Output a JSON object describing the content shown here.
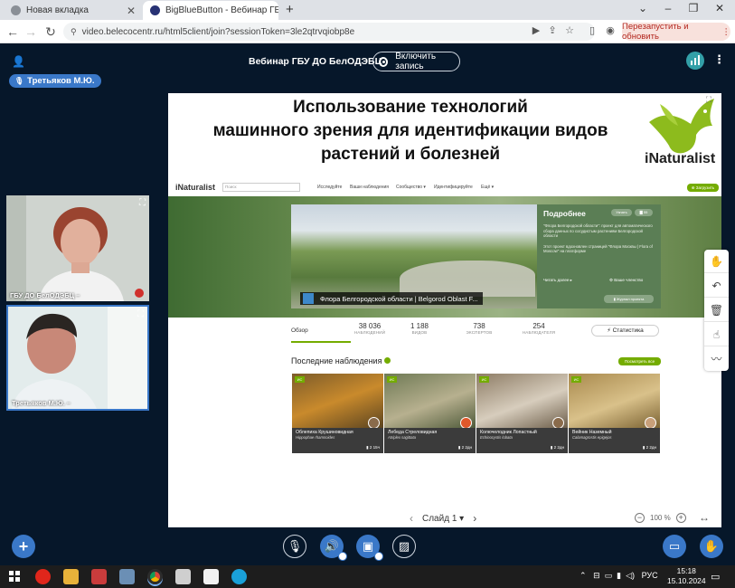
{
  "browser": {
    "tabs": [
      {
        "title": "Новая вкладка",
        "active": false
      },
      {
        "title": "BigBlueButton - Вебинар ГБ",
        "active": true
      }
    ],
    "url": "video.belecocentr.ru/html5client/join?sessionToken=3le2qtrvqiobp8e",
    "relaunch_label": "Перезапустить и обновить",
    "new_tab_symbol": "+"
  },
  "meeting": {
    "title": "Вебинар ГБУ ДО БелОДЭБЦ",
    "record_label": "Включить запись",
    "talking_user": "Третьяков М.Ю."
  },
  "webcams": [
    {
      "label": "ГБУ ДО БелОДЭБЦ –",
      "muted": true
    },
    {
      "label": "Третьяков М.Ю. –",
      "muted": false
    }
  ],
  "slide": {
    "title_lines": [
      "Использование технологий",
      "машинного зрения для идентификации видов",
      "растений и болезней"
    ],
    "logo_text": "iNaturalist",
    "inat": {
      "logo": "iNaturalist",
      "search_placeholder": "Поиск",
      "menu": [
        "Исследуйте",
        "Ваши наблюдения",
        "Сообщество ▾",
        "Идентифицируйте",
        "Ещё ▾"
      ],
      "upload": "⊕ Загрузить",
      "project_title": "Флора Белгородской области | Belgorod Oblast F...",
      "info_heading": "Подробнее",
      "info_text_1": "\"Флора Белгородской области\": проект для автоматического сбора данных по сосудистым растениям Белгородской области",
      "info_text_2": "Этот проект вдохновлен страницей \"Флора Москвы | Flora of Moscow\" на платформе",
      "read_more": "Читать далее ▸",
      "membership": "⚙ Ваше членство",
      "follow": "Узнать",
      "follow_count": "▇ 55",
      "rules": "▮ Журнал проекта",
      "overview_tab": "Обзор",
      "stats": [
        {
          "value": "38 036",
          "label": "НАБЛЮДЕНИЙ"
        },
        {
          "value": "1 188",
          "label": "ВИДОВ"
        },
        {
          "value": "738",
          "label": "ЭКСПЕРТОВ"
        },
        {
          "value": "254",
          "label": "НАБЛЮДАТЕЛЯ"
        }
      ],
      "stats_button": "⚡ Статистика",
      "recent_title": "Последние наблюдения",
      "see_all": "Посмотреть все",
      "observations": [
        {
          "tag": "ИС",
          "common": "Облепиха Крушиновидная",
          "sci": "Hippophae rhamnoides",
          "age": "▮ 2 15ч",
          "color_a": "#7d5c2a",
          "color_b": "#c98a2c"
        },
        {
          "tag": "ИС",
          "common": "Лебеда Стреловидная",
          "sci": "Atriplex sagittata",
          "age": "▮ 2 2дн",
          "color_a": "#6f7a55",
          "color_b": "#b7b08f"
        },
        {
          "tag": "ИС",
          "common": "Колючелодник Лопастный",
          "sci": "Echinocystis lobata",
          "age": "▮ 2 2дн",
          "color_a": "#8e7d66",
          "color_b": "#d7cdbd"
        },
        {
          "tag": "ИС",
          "common": "Вейник Наземный",
          "sci": "Calamagrostis epigejos",
          "age": "▮ 2 2дн",
          "color_a": "#a98a4e",
          "color_b": "#d9c18a"
        }
      ]
    }
  },
  "presentation_bar": {
    "slide_label": "Слайд 1",
    "zoom": "100 %"
  },
  "taskbar": {
    "language": "РУС",
    "time": "15:18",
    "date": "15.10.2024"
  },
  "colors": {
    "bbb_background": "#06172a",
    "bbb_primary": "#3a78c8",
    "inat_green": "#74ac00"
  }
}
